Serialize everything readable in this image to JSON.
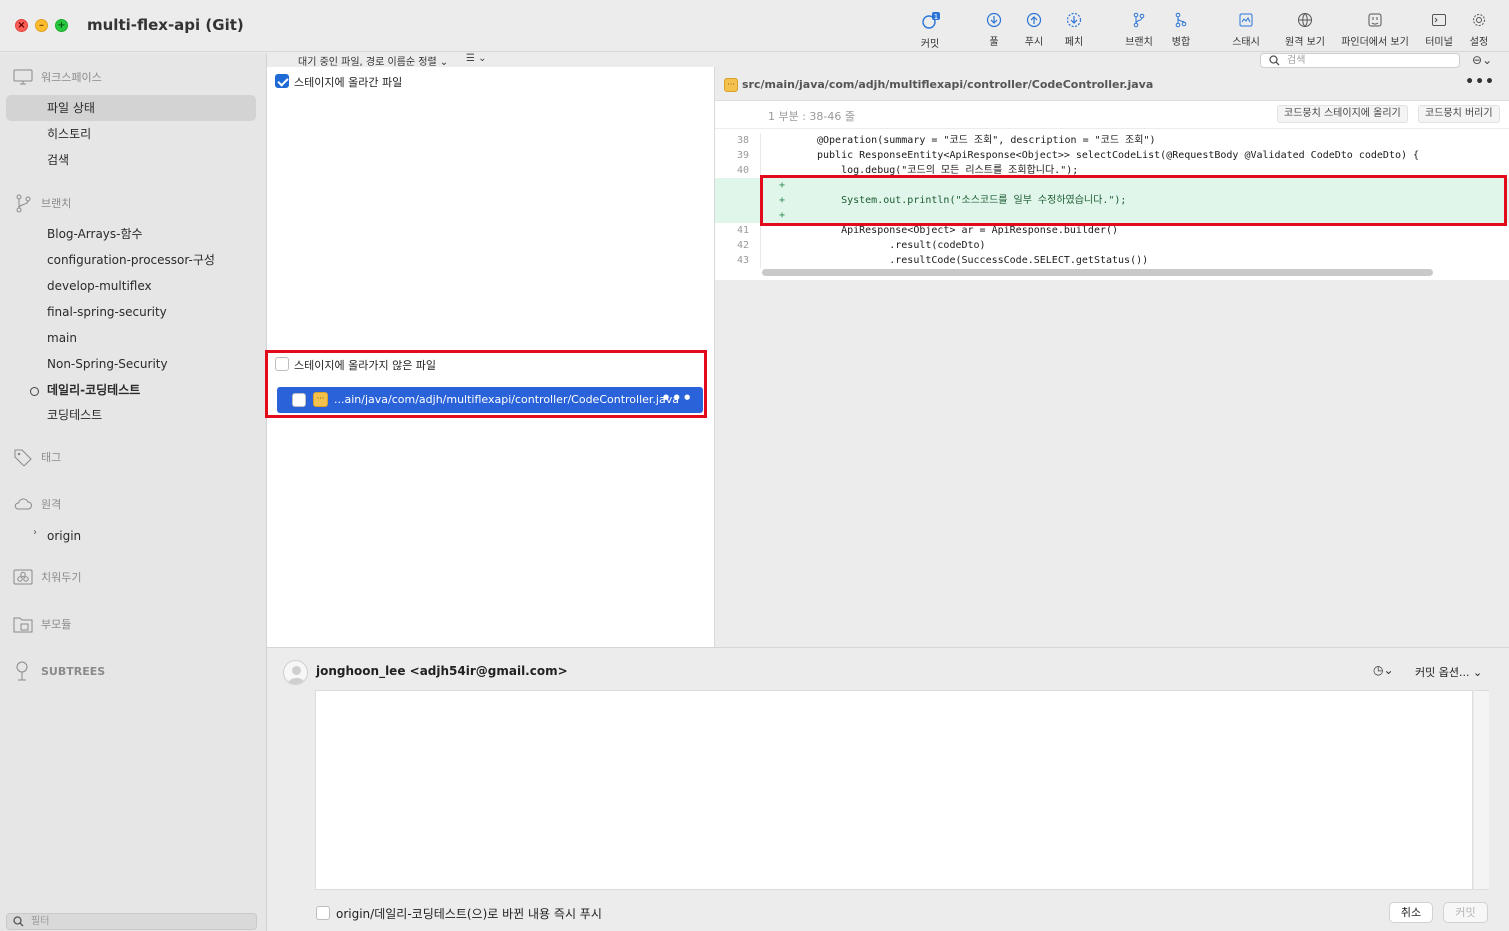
{
  "window": {
    "title": "multi-flex-api (Git)"
  },
  "toolbar": {
    "commit": "커밋",
    "commit_badge": "1",
    "pull": "풀",
    "push": "푸시",
    "fetch": "페치",
    "branch": "브랜치",
    "merge": "병합",
    "stash": "스태시",
    "remote_view": "원격 보기",
    "finder_view": "파인더에서 보기",
    "terminal": "터미널",
    "settings": "설정"
  },
  "sidebar": {
    "workspace": {
      "label": "워크스페이스",
      "items": [
        "파일 상태",
        "히스토리",
        "검색"
      ]
    },
    "branches": {
      "label": "브랜치",
      "items": [
        "Blog-Arrays-함수",
        "configuration-processor-구성",
        "develop-multiflex",
        "final-spring-security",
        "main",
        "Non-Spring-Security",
        "데일리-코딩테스트",
        "코딩테스트"
      ],
      "current": "데일리-코딩테스트"
    },
    "tags": {
      "label": "태그"
    },
    "remotes": {
      "label": "원격",
      "items": [
        "origin"
      ]
    },
    "stashes": {
      "label": "치워두기"
    },
    "submodules": {
      "label": "부모듈"
    },
    "subtrees": {
      "label": "SUBTREES"
    },
    "filter_placeholder": "필터"
  },
  "filelist": {
    "sort_label": "대기 중인 파일, 경로 이름순 정렬",
    "staged_label": "스테이지에 올라간 파일",
    "staged_checked": true,
    "unstaged_label": "스테이지에 올라가지 않은 파일",
    "unstaged_checked": false,
    "unstaged_files": [
      {
        "path": "...ain/java/com/adjh/multiflexapi/controller/CodeController.java",
        "badge": "···"
      }
    ]
  },
  "diff": {
    "search_placeholder": "검색",
    "file_path": "src/main/java/com/adjh/multiflexapi/controller/CodeController.java",
    "hunk_label": "1 부분 : 38-46 줄",
    "stage_hunk": "코드뭉치 스테이지에 올리기",
    "discard_hunk": "코드뭉치 버리기",
    "lines": [
      {
        "num": "38",
        "mark": "",
        "code": "@Operation(summary = \"코드 조회\", description = \"코드 조회\")",
        "added": false
      },
      {
        "num": "39",
        "mark": "",
        "code": "public ResponseEntity<ApiResponse<Object>> selectCodeList(@RequestBody @Validated CodeDto codeDto) {",
        "added": false
      },
      {
        "num": "40",
        "mark": "",
        "code": "    log.debug(\"코드의 모든 리스트를 조회합니다.\");",
        "added": false
      },
      {
        "num": "",
        "mark": "+",
        "code": "",
        "added": true
      },
      {
        "num": "",
        "mark": "+",
        "code": "    System.out.println(\"소스코드를 일부 수정하였습니다.\");",
        "added": true
      },
      {
        "num": "",
        "mark": "+",
        "code": "",
        "added": true
      },
      {
        "num": "41",
        "mark": "",
        "code": "    ApiResponse<Object> ar = ApiResponse.builder()",
        "added": false
      },
      {
        "num": "42",
        "mark": "",
        "code": "            .result(codeDto)",
        "added": false
      },
      {
        "num": "43",
        "mark": "",
        "code": "            .resultCode(SuccessCode.SELECT.getStatus())",
        "added": false
      }
    ]
  },
  "commit": {
    "author": "jonghoon_lee <adjh54ir@gmail.com>",
    "options": "커밋 옵션...",
    "message": "",
    "push_immediately_label": "origin/데일리-코딩테스트(으)로 바뀐 내용 즉시 푸시",
    "push_checked": false,
    "cancel": "취소",
    "commit": "커밋"
  },
  "colors": {
    "accent": "#2a62d9",
    "highlight_border": "#e30a1c",
    "added_line": "#e1f6ea"
  }
}
